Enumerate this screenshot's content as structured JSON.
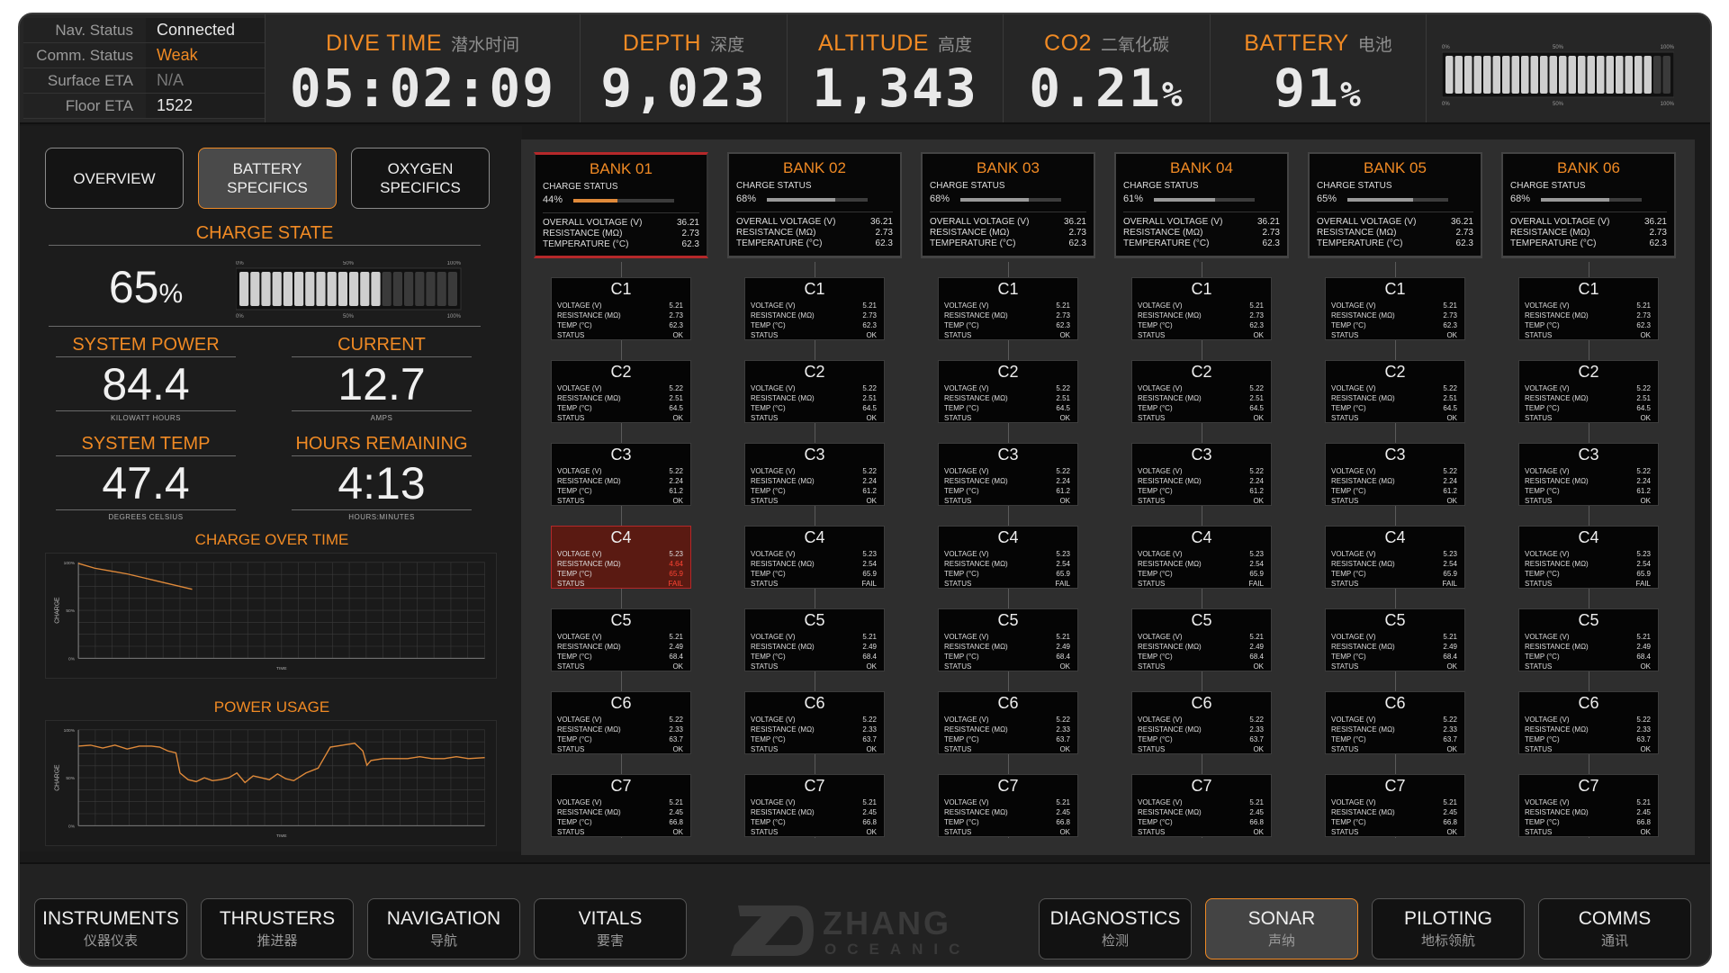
{
  "status": [
    {
      "key": "Nav. Status",
      "value": "Connected",
      "style": "normal"
    },
    {
      "key": "Comm. Status",
      "value": "Weak",
      "style": "warn"
    },
    {
      "key": "Surface ETA",
      "value": "N/A",
      "style": "dim"
    },
    {
      "key": "Floor ETA",
      "value": "1522",
      "style": "normal"
    }
  ],
  "stats": {
    "dive": {
      "label": "DIVE TIME",
      "cn": "潜水时间",
      "value": "05:02:09",
      "unit": ""
    },
    "depth": {
      "label": "DEPTH",
      "cn": "深度",
      "value": "9,023",
      "unit": ""
    },
    "altitude": {
      "label": "ALTITUDE",
      "cn": "高度",
      "value": "1,343",
      "unit": ""
    },
    "co2": {
      "label": "CO2",
      "cn": "二氧化碳",
      "value": "0.21",
      "unit": "%"
    },
    "battery": {
      "label": "BATTERY",
      "cn": "电池",
      "value": "91",
      "unit": "%"
    }
  },
  "battery_gauge": {
    "level_percent": 91,
    "scale_top": [
      "0%",
      "50%",
      "100%"
    ],
    "scale_bottom": [
      "0%",
      "50%",
      "100%"
    ]
  },
  "tabs": {
    "overview": "OVERVIEW",
    "battery_l1": "BATTERY",
    "battery_l2": "SPECIFICS",
    "oxygen_l1": "OXYGEN",
    "oxygen_l2": "SPECIFICS"
  },
  "charge": {
    "title": "CHARGE STATE",
    "value": "65",
    "unit": "%",
    "level_percent": 65,
    "scale": [
      "0%",
      "50%",
      "100%"
    ]
  },
  "metrics": {
    "power": {
      "title": "SYSTEM POWER",
      "value": "84.4",
      "sub": "KILOWATT HOURS"
    },
    "current": {
      "title": "CURRENT",
      "value": "12.7",
      "sub": "AMPS"
    },
    "temp": {
      "title": "SYSTEM TEMP",
      "value": "47.4",
      "sub": "DEGREES CELSIUS"
    },
    "hours": {
      "title": "HOURS REMAINING",
      "value": "4:13",
      "sub": "HOURS:MINUTES"
    }
  },
  "chart_data": [
    {
      "type": "line",
      "title": "CHARGE OVER TIME",
      "xlabel": "TIME",
      "ylabel": "CHARGE",
      "yticks": [
        "100%",
        "50%",
        "0%"
      ],
      "ylim": [
        0,
        100
      ],
      "xlim": [
        0,
        100
      ],
      "grid": true,
      "series": [
        {
          "x": [
            0,
            4,
            8,
            12,
            16,
            20,
            24,
            28
          ],
          "values": [
            99,
            94,
            91,
            88,
            84,
            80,
            76,
            72
          ]
        }
      ]
    },
    {
      "type": "line",
      "title": "POWER USAGE",
      "xlabel": "TIME",
      "ylabel": "CHARGE",
      "yticks": [
        "100%",
        "50%",
        "0%"
      ],
      "ylim": [
        0,
        100
      ],
      "xlim": [
        0,
        100
      ],
      "grid": true,
      "series": [
        {
          "x": [
            0,
            3,
            6,
            9,
            12,
            15,
            18,
            20,
            22,
            24,
            25,
            27,
            29,
            31,
            33,
            35,
            37,
            39,
            41,
            43,
            45,
            47,
            49,
            51,
            53,
            56,
            59,
            62,
            65,
            68,
            70,
            71,
            72,
            75,
            78,
            81,
            84,
            87,
            90,
            93,
            96,
            100
          ],
          "values": [
            83,
            84,
            81,
            84,
            80,
            83,
            83,
            82,
            78,
            76,
            55,
            48,
            46,
            50,
            47,
            48,
            50,
            55,
            45,
            52,
            50,
            48,
            54,
            49,
            47,
            55,
            60,
            82,
            84,
            86,
            78,
            63,
            68,
            70,
            70,
            70,
            72,
            70,
            70,
            72,
            70,
            71
          ]
        }
      ]
    }
  ],
  "banks": [
    {
      "name": "BANK 01",
      "charge_label": "CHARGE STATUS",
      "charge": "44%",
      "charge_level": 44,
      "alert": true,
      "specs": [
        [
          "OVERALL VOLTAGE (V)",
          "36.21"
        ],
        [
          "RESISTANCE (MΩ)",
          "2.73"
        ],
        [
          "TEMPERATURE (°C)",
          "62.3"
        ]
      ]
    },
    {
      "name": "BANK 02",
      "charge_label": "CHARGE STATUS",
      "charge": "68%",
      "charge_level": 68,
      "alert": false,
      "specs": [
        [
          "OVERALL VOLTAGE (V)",
          "36.21"
        ],
        [
          "RESISTANCE (MΩ)",
          "2.73"
        ],
        [
          "TEMPERATURE (°C)",
          "62.3"
        ]
      ]
    },
    {
      "name": "BANK 03",
      "charge_label": "CHARGE STATUS",
      "charge": "68%",
      "charge_level": 68,
      "alert": false,
      "specs": [
        [
          "OVERALL VOLTAGE (V)",
          "36.21"
        ],
        [
          "RESISTANCE (MΩ)",
          "2.73"
        ],
        [
          "TEMPERATURE (°C)",
          "62.3"
        ]
      ]
    },
    {
      "name": "BANK 04",
      "charge_label": "CHARGE STATUS",
      "charge": "61%",
      "charge_level": 61,
      "alert": false,
      "specs": [
        [
          "OVERALL VOLTAGE (V)",
          "36.21"
        ],
        [
          "RESISTANCE (MΩ)",
          "2.73"
        ],
        [
          "TEMPERATURE (°C)",
          "62.3"
        ]
      ]
    },
    {
      "name": "BANK 05",
      "charge_label": "CHARGE STATUS",
      "charge": "65%",
      "charge_level": 65,
      "alert": false,
      "specs": [
        [
          "OVERALL VOLTAGE (V)",
          "36.21"
        ],
        [
          "RESISTANCE (MΩ)",
          "2.73"
        ],
        [
          "TEMPERATURE (°C)",
          "62.3"
        ]
      ]
    },
    {
      "name": "BANK 06",
      "charge_label": "CHARGE STATUS",
      "charge": "68%",
      "charge_level": 68,
      "alert": false,
      "specs": [
        [
          "OVERALL VOLTAGE (V)",
          "36.21"
        ],
        [
          "RESISTANCE (MΩ)",
          "2.73"
        ],
        [
          "TEMPERATURE (°C)",
          "62.3"
        ]
      ]
    }
  ],
  "cell_labels": [
    "VOLTAGE (V)",
    "RESISTANCE (MΩ)",
    "TEMP (°C)",
    "STATUS"
  ],
  "cells": [
    {
      "name": "C1",
      "values": [
        "5.21",
        "2.73",
        "62.3",
        "OK"
      ]
    },
    {
      "name": "C2",
      "values": [
        "5.22",
        "2.51",
        "64.5",
        "OK"
      ]
    },
    {
      "name": "C3",
      "values": [
        "5.22",
        "2.24",
        "61.2",
        "OK"
      ]
    },
    {
      "name": "C4",
      "values": [
        "5.23",
        "2.54",
        "65.9",
        "FAIL"
      ]
    },
    {
      "name": "C5",
      "values": [
        "5.21",
        "2.49",
        "68.4",
        "OK"
      ]
    },
    {
      "name": "C6",
      "values": [
        "5.22",
        "2.33",
        "63.7",
        "OK"
      ]
    },
    {
      "name": "C7",
      "values": [
        "5.21",
        "2.45",
        "66.8",
        "OK"
      ]
    }
  ],
  "fail_cell": {
    "bank": 0,
    "cell": 3,
    "values": [
      "5.23",
      "4.64",
      "65.9",
      "FAIL"
    ]
  },
  "bottom_nav": [
    {
      "en": "INSTRUMENTS",
      "cn": "仪器仪表",
      "active": false
    },
    {
      "en": "THRUSTERS",
      "cn": "推进器",
      "active": false
    },
    {
      "en": "NAVIGATION",
      "cn": "导航",
      "active": false
    },
    {
      "en": "VITALS",
      "cn": "要害",
      "active": false
    },
    {
      "en": "DIAGNOSTICS",
      "cn": "检测",
      "active": false
    },
    {
      "en": "SONAR",
      "cn": "声纳",
      "active": true
    },
    {
      "en": "PILOTING",
      "cn": "地标领航",
      "active": false
    },
    {
      "en": "COMMS",
      "cn": "通讯",
      "active": false
    }
  ],
  "logo": {
    "name": "ZHANG",
    "sub": "OCEANIC"
  },
  "colors": {
    "accent": "#f08a24",
    "alert": "#b5282a",
    "fail_bg": "#5a1a12",
    "panel": "#1a1a1a"
  }
}
